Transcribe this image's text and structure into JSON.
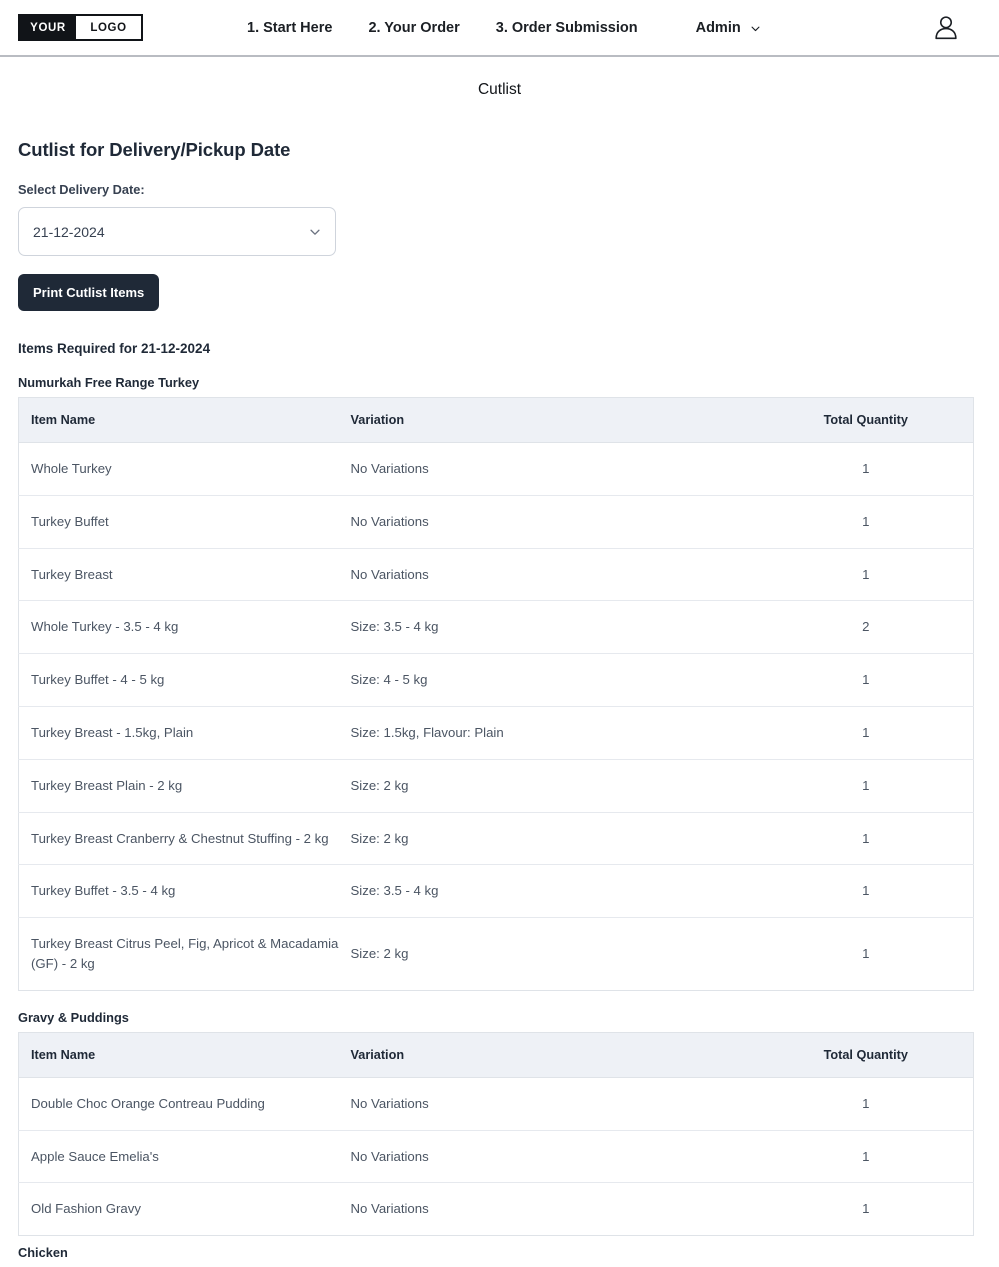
{
  "navbar": {
    "logo": {
      "left_text": "YOUR",
      "right_text": "LOGO"
    },
    "links": [
      {
        "label": "1. Start Here"
      },
      {
        "label": "2. Your Order"
      },
      {
        "label": "3. Order Submission"
      }
    ],
    "admin_label": "Admin",
    "admin_caret_icon": "chevron-down-icon",
    "account_icon": "user-account-icon"
  },
  "page": {
    "title": "Cutlist",
    "section_heading": "Cutlist for Delivery/Pickup Date",
    "date_field_label": "Select Delivery Date:",
    "selected_date": "21-12-2024",
    "date_select_caret_icon": "chevron-down-icon",
    "print_button_label": "Print Cutlist Items",
    "items_required_label": "Items Required for 21-12-2024"
  },
  "table_columns": {
    "item_name": "Item Name",
    "variation": "Variation",
    "total_quantity": "Total Quantity"
  },
  "groups": [
    {
      "title": "Numurkah Free Range Turkey",
      "rows": [
        {
          "name": "Whole Turkey",
          "variation": "No Variations",
          "qty": "1"
        },
        {
          "name": "Turkey Buffet",
          "variation": "No Variations",
          "qty": "1"
        },
        {
          "name": "Turkey Breast",
          "variation": "No Variations",
          "qty": "1"
        },
        {
          "name": "Whole Turkey - 3.5 - 4 kg",
          "variation": "Size: 3.5 - 4 kg",
          "qty": "2"
        },
        {
          "name": "Turkey Buffet - 4 - 5 kg",
          "variation": "Size: 4 - 5 kg",
          "qty": "1"
        },
        {
          "name": "Turkey Breast - 1.5kg, Plain",
          "variation": "Size: 1.5kg, Flavour: Plain",
          "qty": "1"
        },
        {
          "name": "Turkey Breast Plain - 2 kg",
          "variation": "Size: 2 kg",
          "qty": "1"
        },
        {
          "name": "Turkey Breast Cranberry & Chestnut Stuffing - 2 kg",
          "variation": "Size: 2 kg",
          "qty": "1"
        },
        {
          "name": "Turkey Buffet - 3.5 - 4 kg",
          "variation": "Size: 3.5 - 4 kg",
          "qty": "1"
        },
        {
          "name": "Turkey Breast Citrus Peel, Fig, Apricot & Macadamia (GF) - 2 kg",
          "variation": "Size: 2 kg",
          "qty": "1"
        }
      ]
    },
    {
      "title": "Gravy & Puddings",
      "rows": [
        {
          "name": "Double Choc Orange Contreau Pudding",
          "variation": "No Variations",
          "qty": "1"
        },
        {
          "name": "Apple Sauce Emelia's",
          "variation": "No Variations",
          "qty": "1"
        },
        {
          "name": "Old Fashion Gravy",
          "variation": "No Variations",
          "qty": "1"
        }
      ]
    },
    {
      "title": "Chicken",
      "rows": []
    }
  ],
  "colors": {
    "accent_dark": "#1f2937",
    "table_header_bg": "#eef1f6",
    "border": "#dfe3e8",
    "text_body": "#4b5563"
  }
}
